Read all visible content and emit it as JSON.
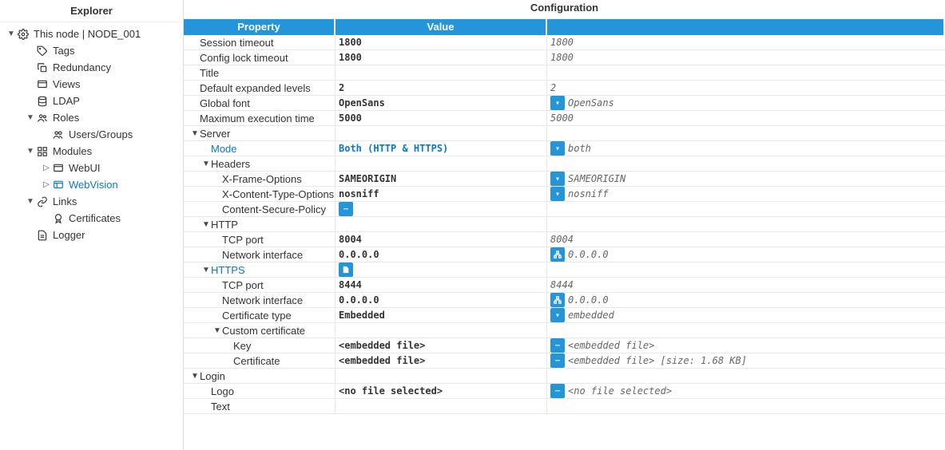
{
  "explorer": {
    "title": "Explorer",
    "nodeLabel": "This node | NODE_001",
    "tags": "Tags",
    "redundancy": "Redundancy",
    "views": "Views",
    "ldap": "LDAP",
    "roles": "Roles",
    "usersGroups": "Users/Groups",
    "modules": "Modules",
    "webui": "WebUI",
    "webvision": "WebVision",
    "links": "Links",
    "certificates": "Certificates",
    "logger": "Logger"
  },
  "config": {
    "title": "Configuration",
    "headers": {
      "property": "Property",
      "value": "Value"
    }
  },
  "rows": {
    "sessionTimeout": {
      "label": "Session timeout",
      "value": "1800",
      "default": "1800"
    },
    "configLockTimeout": {
      "label": "Config lock timeout",
      "value": "1800",
      "default": "1800"
    },
    "title": {
      "label": "Title",
      "value": "",
      "default": ""
    },
    "defaultExpanded": {
      "label": "Default expanded levels",
      "value": "2",
      "default": "2"
    },
    "globalFont": {
      "label": "Global font",
      "value": "OpenSans",
      "default": "OpenSans"
    },
    "maxExec": {
      "label": "Maximum execution time",
      "value": "5000",
      "default": "5000"
    },
    "server": {
      "label": "Server"
    },
    "mode": {
      "label": "Mode",
      "value": "Both (HTTP & HTTPS)",
      "default": "both"
    },
    "headers": {
      "label": "Headers"
    },
    "xframe": {
      "label": "X-Frame-Options",
      "value": "SAMEORIGIN",
      "default": "SAMEORIGIN"
    },
    "xcontent": {
      "label": "X-Content-Type-Options",
      "value": "nosniff",
      "default": "nosniff"
    },
    "csp": {
      "label": "Content-Secure-Policy"
    },
    "http": {
      "label": "HTTP"
    },
    "httpPort": {
      "label": "TCP port",
      "value": "8004",
      "default": "8004"
    },
    "httpIf": {
      "label": "Network interface",
      "value": "0.0.0.0",
      "default": "0.0.0.0"
    },
    "https": {
      "label": "HTTPS"
    },
    "httpsPort": {
      "label": "TCP port",
      "value": "8444",
      "default": "8444"
    },
    "httpsIf": {
      "label": "Network interface",
      "value": "0.0.0.0",
      "default": "0.0.0.0"
    },
    "certType": {
      "label": "Certificate type",
      "value": "Embedded",
      "default": "embedded"
    },
    "customCert": {
      "label": "Custom certificate"
    },
    "key": {
      "label": "Key",
      "value": "<embedded file>",
      "default": "<embedded file>"
    },
    "cert": {
      "label": "Certificate",
      "value": "<embedded file>",
      "default": "<embedded file> [size: 1.68 KB]"
    },
    "login": {
      "label": "Login"
    },
    "logo": {
      "label": "Logo",
      "value": "<no file selected>",
      "default": "<no file selected>"
    },
    "text": {
      "label": "Text",
      "value": "",
      "default": ""
    }
  }
}
